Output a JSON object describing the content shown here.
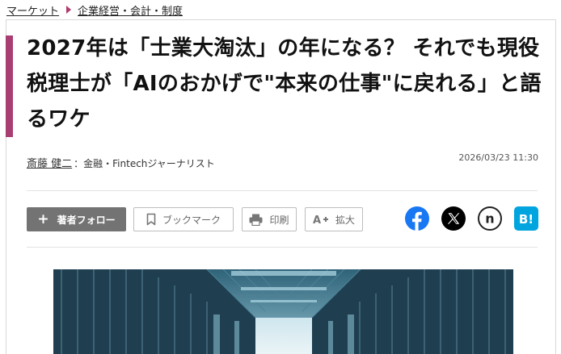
{
  "breadcrumb": {
    "items": [
      "マーケット",
      "企業経営・会計・制度"
    ]
  },
  "article": {
    "title": "2027年は「士業大淘汰」の年になる？ それでも現役税理士が「AIのおかげで\"本来の仕事\"に戻れる」と語るワケ",
    "author_name": "斎藤 健二",
    "author_role": "：金融・Fintechジャーナリスト",
    "date": "2026/03/23 11:30"
  },
  "actions": {
    "follow_label": "著者フォロー",
    "bookmark_label": "ブックマーク",
    "print_label": "印刷",
    "zoom_label": "拡大"
  },
  "share": {
    "facebook": "facebook-icon",
    "x": "x-icon",
    "note": "note-icon",
    "hatena": "hatena-bookmark-icon",
    "hatena_text": "B!",
    "note_text": "n"
  },
  "colors": {
    "accent": "#a83e72",
    "facebook": "#1877f2",
    "hatena": "#00a4de"
  }
}
